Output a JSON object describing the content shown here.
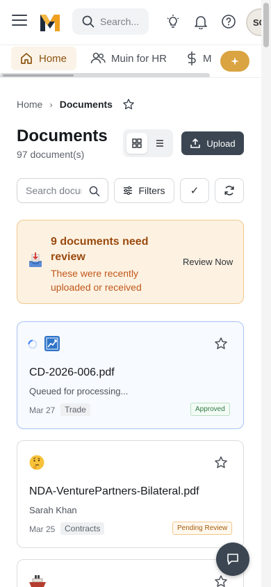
{
  "header": {
    "search_placeholder": "Search...",
    "user_initials": "SC"
  },
  "tabs": [
    {
      "label": "Home",
      "active": true
    },
    {
      "label": "Muin for HR",
      "active": false
    },
    {
      "label": "M",
      "active": false
    }
  ],
  "breadcrumb": {
    "home": "Home",
    "current": "Documents"
  },
  "page": {
    "title": "Documents",
    "count_text": "97 document(s)",
    "upload_label": "Upload"
  },
  "filters": {
    "search_placeholder": "Search documents",
    "filters_label": "Filters",
    "select_glyph": "✓"
  },
  "review_banner": {
    "title": "9 documents need review",
    "subtitle": "These were recently uploaded or received",
    "action_label": "Review Now"
  },
  "documents": [
    {
      "name": "CD-2026-006.pdf",
      "subtitle": "Queued for processing...",
      "date": "Mar 27",
      "tag": "Trade",
      "status": "Approved"
    },
    {
      "name": "NDA-VenturePartners-Bilateral.pdf",
      "subtitle": "Sarah Khan",
      "date": "Mar 25",
      "tag": "Contracts",
      "status": "Pending Review"
    }
  ],
  "colors": {
    "brand_orange": "#f0a020",
    "brand_dark": "#1e2a3a",
    "accent_button": "#3b4652",
    "banner_bg": "#fdf2e2",
    "banner_title": "#9a4a0e",
    "approved_green": "#2f7a46",
    "pending_orange": "#a55d0c"
  },
  "icons": {
    "menu": "hamburger-icon",
    "search": "search-icon",
    "bulb": "lightbulb-icon",
    "bell": "bell-icon",
    "help": "help-icon",
    "home": "home-icon",
    "users": "users-icon",
    "dollar": "dollar-icon",
    "sparkle": "sparkle-icon",
    "star": "star-icon",
    "grid": "grid-view-icon",
    "list": "list-view-icon",
    "upload": "upload-icon",
    "filter": "filter-icon",
    "refresh": "refresh-icon",
    "inbox": "inbox-tray-icon",
    "chat": "chat-icon"
  }
}
